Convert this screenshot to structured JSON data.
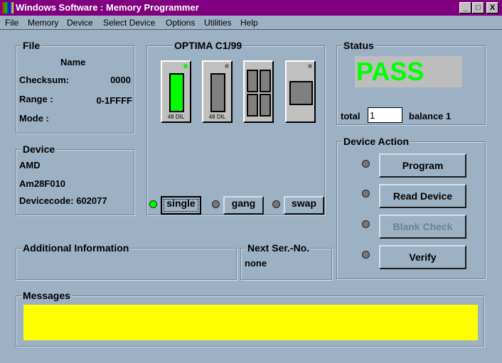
{
  "window": {
    "title": "Windows Software :  Memory Programmer",
    "min": "_",
    "max": "□",
    "close": "X"
  },
  "menu": [
    "File",
    "Memory",
    "Device",
    "Select Device",
    "Options",
    "Utilities",
    "Help"
  ],
  "file": {
    "title": "File",
    "name_label": "Name",
    "checksum_label": "Checksum:",
    "checksum": "0000",
    "range_label": "Range :",
    "range": "0-1FFFF",
    "mode_label": "Mode :"
  },
  "device": {
    "title": "Device",
    "vendor": "AMD",
    "part": "Am28F010",
    "devicecode": "Devicecode: 602077"
  },
  "optima": {
    "title": "OPTIMA  C1/99",
    "cards": [
      {
        "label": "48 DIL",
        "active": true
      },
      {
        "label": "48 DIL",
        "active": false
      },
      {
        "label": "",
        "active": false
      },
      {
        "label": "",
        "active": false
      }
    ],
    "modes": [
      {
        "label": "single",
        "active": true
      },
      {
        "label": "gang",
        "active": false
      },
      {
        "label": "swap",
        "active": false
      }
    ]
  },
  "status": {
    "title": "Status",
    "result": "PASS",
    "total_label": "total",
    "total": "1",
    "balance": "balance 1",
    "colors": {
      "pass": "#00ff00",
      "box": "#bdbdbd"
    }
  },
  "actions": {
    "title": "Device Action",
    "buttons": [
      {
        "label": "Program",
        "enabled": true
      },
      {
        "label": "Read Device",
        "enabled": true
      },
      {
        "label": "Blank Check",
        "enabled": false
      },
      {
        "label": "Verify",
        "enabled": true
      }
    ]
  },
  "additional": {
    "title": "Additional Information"
  },
  "next": {
    "title": "Next Ser.-No.",
    "value": "none"
  },
  "messages": {
    "title": "Messages",
    "color": "#ffff00"
  }
}
